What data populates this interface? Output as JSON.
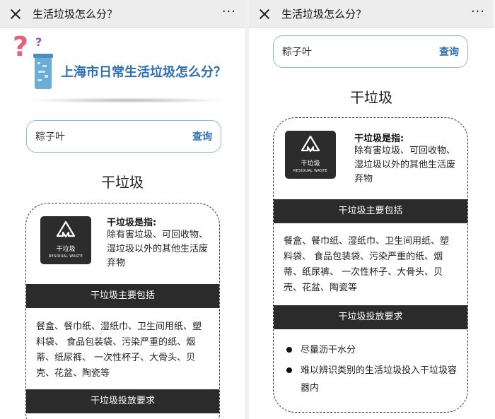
{
  "window": {
    "title": "生活垃圾怎么分？",
    "more": "···"
  },
  "banner": {
    "title": "上海市日常生活垃圾怎么分？"
  },
  "search": {
    "value": "粽子叶",
    "button": "查询"
  },
  "result": {
    "category": "干垃圾",
    "logo": {
      "cn": "干垃圾",
      "en": "RESIDUAL WASTE"
    },
    "definition": {
      "title": "干垃圾是指:",
      "text": "除有害垃圾、可回收物、 湿垃圾以外的其他生活废弃物"
    },
    "includes": {
      "header": "干垃圾主要包括",
      "text": "餐盒、餐巾纸、湿纸巾、卫生间用纸、塑料袋、 食品包装袋、污染严重的纸、烟蒂、纸尿裤、 一次性杯子、大骨头、贝壳、花盆、陶瓷等"
    },
    "requirements": {
      "header": "干垃圾投放要求",
      "items": [
        "尽量沥干水分",
        "难以辨识类别的生活垃圾投入干垃圾容器内"
      ]
    }
  },
  "colors": {
    "accent": "#2e6fb5",
    "bar": "#2b2b2b",
    "search_border": "#8fb7dd"
  }
}
